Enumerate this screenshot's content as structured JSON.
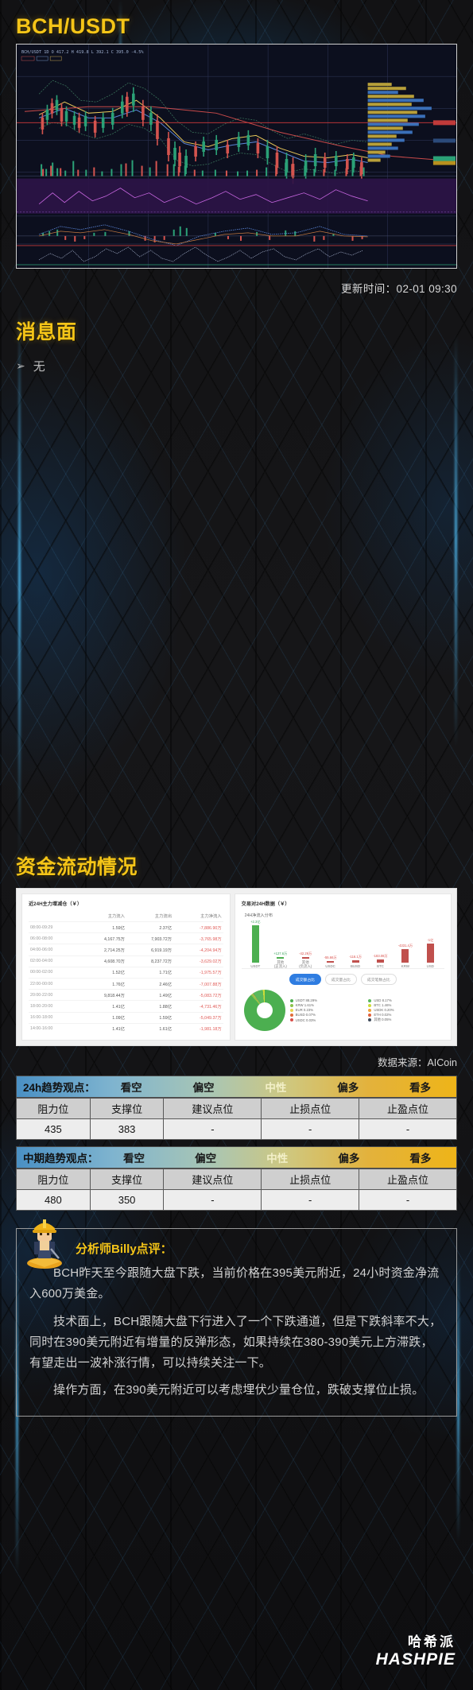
{
  "header": {
    "pair_title": "BCH/USDT"
  },
  "kline": {
    "legend": "K线(BCH/USDT) 1D  开 417.2 高 419.8 低 392.1 收 395.0",
    "caption": "BCH/USDT candlestick chart with volume profile, MACD and RSI sub-panels"
  },
  "update": {
    "label": "更新时间：02-01 09:30"
  },
  "news": {
    "title": "消息面",
    "arrow": "➢",
    "items": [
      "无"
    ]
  },
  "funds": {
    "title": "资金流动情况",
    "left_panel_title": "近24H主力增减仓（￥）",
    "right_panel_title": "交易对24H数据（￥）",
    "table": {
      "columns": [
        "",
        "主力流入",
        "主力流出",
        "主力净流入"
      ],
      "rows": [
        [
          "08:00-09:29",
          "1.59亿",
          "2.37亿",
          "-7,886.90万"
        ],
        [
          "06:00-08:00",
          "4,167.75万",
          "7,903.72万",
          "-3,765.98万"
        ],
        [
          "04:00-06:00",
          "2,714.25万",
          "6,919.19万",
          "-4,204.94万"
        ],
        [
          "02:00-04:00",
          "4,608.70万",
          "8,237.72万",
          "-3,629.02万"
        ],
        [
          "00:00-02:00",
          "1.52亿",
          "1.71亿",
          "-1,975.57万"
        ],
        [
          "22:00-00:00",
          "1.76亿",
          "2.46亿",
          "-7,007.88万"
        ],
        [
          "20:00-22:00",
          "9,818.44万",
          "1.49亿",
          "-5,083.72万"
        ],
        [
          "18:00-20:00",
          "1.41亿",
          "1.88亿",
          "-4,731.46万"
        ],
        [
          "16:00-18:00",
          "1.09亿",
          "1.59亿",
          "-5,049.37万"
        ],
        [
          "14:00-16:00",
          "1.41亿",
          "1.61亿",
          "-1,981.18万"
        ]
      ]
    },
    "bars_title": "24H净流入分布",
    "bars": {
      "labels": [
        "USDT",
        "其他\n(正流入)",
        "其他\n(负流入)",
        "USDC",
        "BUSD",
        "BTC",
        "KRW",
        "USD"
      ],
      "values": [
        "+2.3亿",
        "+127.6万",
        "-42.29万",
        "-55.66万",
        "-116.1万",
        "-183.08万",
        "-4331.4万",
        "-1亿"
      ],
      "signs": [
        "pos",
        "pos",
        "neg",
        "neg",
        "neg",
        "neg",
        "neg",
        "neg"
      ],
      "heights": [
        92,
        3,
        3,
        4,
        5,
        6,
        28,
        40
      ]
    },
    "tabs": [
      {
        "label": "成交额占比",
        "active": true
      },
      {
        "label": "成交量占比",
        "active": false
      },
      {
        "label": "成交笔数占比",
        "active": false
      }
    ],
    "legend": [
      {
        "name": "USDT 88.29%",
        "color": "#4caf50"
      },
      {
        "name": "USD 8.17%",
        "color": "#59b85c"
      },
      {
        "name": "KRW 1.61%",
        "color": "#8bc34a"
      },
      {
        "name": "BTC 1.46%",
        "color": "#cddc39"
      },
      {
        "name": "EUR 0.23%",
        "color": "#e8d44d"
      },
      {
        "name": "USDK 0.20%",
        "color": "#f0a33a"
      },
      {
        "name": "BUSD 0.07%",
        "color": "#e06c3a"
      },
      {
        "name": "ETH 0.02%",
        "color": "#e0603a"
      },
      {
        "name": "USDC 0.03%",
        "color": "#d94f4a"
      },
      {
        "name": "其他 0.05%",
        "color": "#3f4a5a"
      }
    ],
    "source": "数据来源：AICoin"
  },
  "trend_24h": {
    "label": "24h趋势观点：",
    "scale": [
      "看空",
      "偏空",
      "中性",
      "偏多",
      "看多"
    ],
    "columns": [
      "阻力位",
      "支撑位",
      "建议点位",
      "止损点位",
      "止盈点位"
    ],
    "values": [
      "435",
      "383",
      "-",
      "-",
      "-"
    ]
  },
  "trend_mid": {
    "label": "中期趋势观点：",
    "scale": [
      "看空",
      "偏空",
      "中性",
      "偏多",
      "看多"
    ],
    "columns": [
      "阻力位",
      "支撑位",
      "建议点位",
      "止损点位",
      "止盈点位"
    ],
    "values": [
      "480",
      "350",
      "-",
      "-",
      "-"
    ]
  },
  "analyst": {
    "title": "分析师Billy点评：",
    "paragraphs": [
      "BCH昨天至今跟随大盘下跌，当前价格在395美元附近，24小时资金净流入600万美金。",
      "技术面上，BCH跟随大盘下行进入了一个下跌通道，但是下跌斜率不大，同时在390美元附近有增量的反弹形态，如果持续在380-390美元上方滞跌，有望走出一波补涨行情，可以持续关注一下。",
      "操作方面，在390美元附近可以考虑埋伏少量仓位，跌破支撑位止损。"
    ]
  },
  "footer": {
    "brand_cn": "哈希派",
    "brand_en": "HASHPIE"
  },
  "colors": {
    "accent_gold": "#f5c518",
    "up_green": "#4caf50",
    "down_red": "#d94f4a",
    "tab_blue": "#2f7de1"
  }
}
